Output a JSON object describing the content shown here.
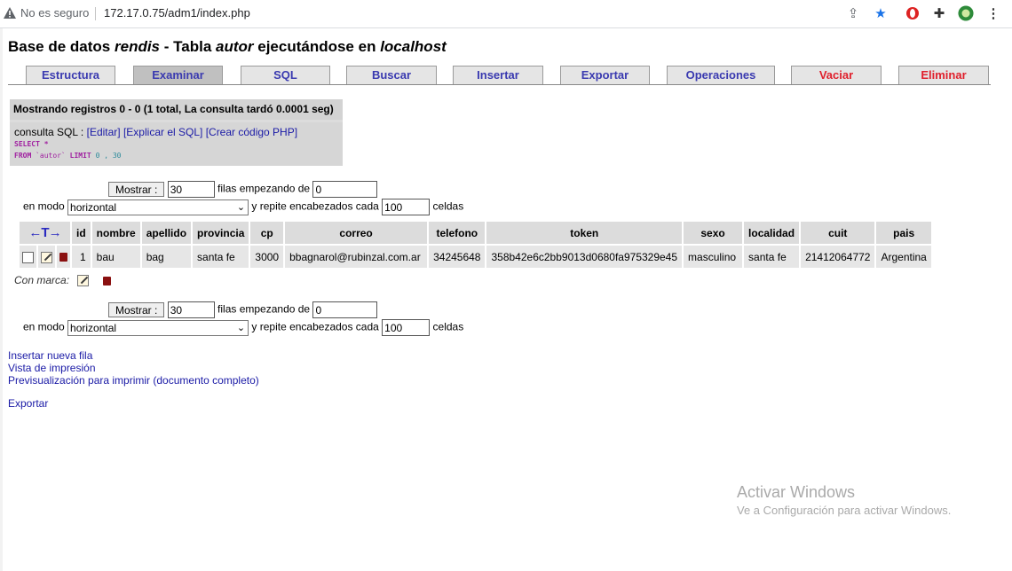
{
  "browser": {
    "not_secure": "No es seguro",
    "url": "172.17.0.75/adm1/index.php"
  },
  "heading": {
    "prefix": "Base de datos ",
    "db": "rendis",
    "mid": " - Tabla ",
    "table": "autor",
    "suffix": " ejecutándose en ",
    "host": "localhost"
  },
  "tabs": [
    {
      "label": "Estructura"
    },
    {
      "label": "Examinar",
      "active": true
    },
    {
      "label": "SQL"
    },
    {
      "label": "Buscar"
    },
    {
      "label": "Insertar"
    },
    {
      "label": "Exportar"
    },
    {
      "label": "Operaciones"
    },
    {
      "label": "Vaciar",
      "danger": true
    },
    {
      "label": "Eliminar",
      "danger": true
    }
  ],
  "info": {
    "header": "Mostrando registros 0 - 0 (1 total, La consulta tardó 0.0001 seg)",
    "query_label": "consulta SQL : ",
    "link_edit": "[Editar]",
    "link_explain": "[Explicar el SQL]",
    "link_php": "[Crear código PHP]",
    "sql_select": "SELECT *",
    "sql_from": "FROM",
    "sql_table": "`autor`",
    "sql_limit": "LIMIT",
    "sql_nums": "0 , 30"
  },
  "nav": {
    "show_button": "Mostrar :",
    "rows_value": "30",
    "rows_text": "filas empezando de",
    "start_value": "0",
    "mode_label": "en modo",
    "mode_value": "horizontal",
    "repeat_text": "y repite encabezados cada",
    "repeat_value": "100",
    "cells_text": "celdas"
  },
  "columns": [
    "id",
    "nombre",
    "apellido",
    "provincia",
    "cp",
    "correo",
    "telefono",
    "token",
    "sexo",
    "localidad",
    "cuit",
    "pais"
  ],
  "row": [
    "1",
    "bau",
    "bag",
    "santa fe",
    "3000",
    "bbagnarol@rubinzal.com.ar",
    "34245648",
    "358b42e6c2bb9013d0680fa975329e45",
    "masculino",
    "santa fe",
    "21412064772",
    "Argentina"
  ],
  "con_marca": "Con marca:",
  "links": {
    "insert": "Insertar nueva fila",
    "print_view": "Vista de impresión",
    "print_full": "Previsualización para imprimir (documento completo)",
    "export": "Exportar"
  },
  "watermark": {
    "title": "Activar Windows",
    "sub": "Ve a Configuración para activar Windows."
  },
  "colors": {
    "tab_text": "#3a3ab0",
    "danger": "#e0202c",
    "link": "#1a1aa6"
  }
}
